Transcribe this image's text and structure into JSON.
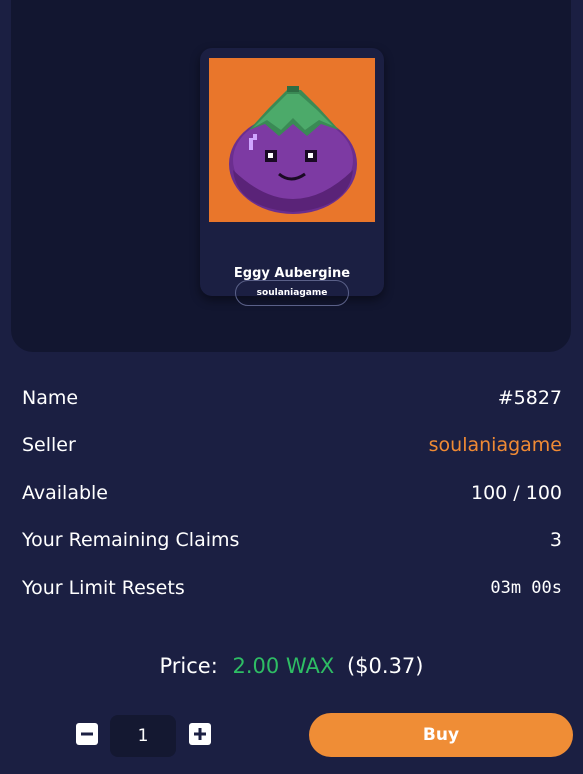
{
  "card": {
    "collection": "soulaniagame",
    "name": "Eggy Aubergine",
    "image_icon": "eggplant-character-icon",
    "image_background": "#e9762b"
  },
  "details": {
    "name_label": "Name",
    "name_value": "#5827",
    "seller_label": "Seller",
    "seller_value": "soulaniagame",
    "available_label": "Available",
    "available_value": "100 / 100",
    "claims_label": "Your Remaining Claims",
    "claims_value": "3",
    "resets_label": "Your Limit Resets",
    "resets_value": "03m 00s"
  },
  "price": {
    "label": "Price:",
    "value": "2.00 WAX",
    "usd": "($0.37)"
  },
  "purchase": {
    "quantity": "1",
    "minus_icon": "minus-icon",
    "plus_icon": "plus-icon",
    "buy_label": "Buy"
  },
  "colors": {
    "accent_orange": "#ef8d36",
    "price_green": "#2ebd64",
    "background": "#1b1f42",
    "panel": "#121630"
  }
}
